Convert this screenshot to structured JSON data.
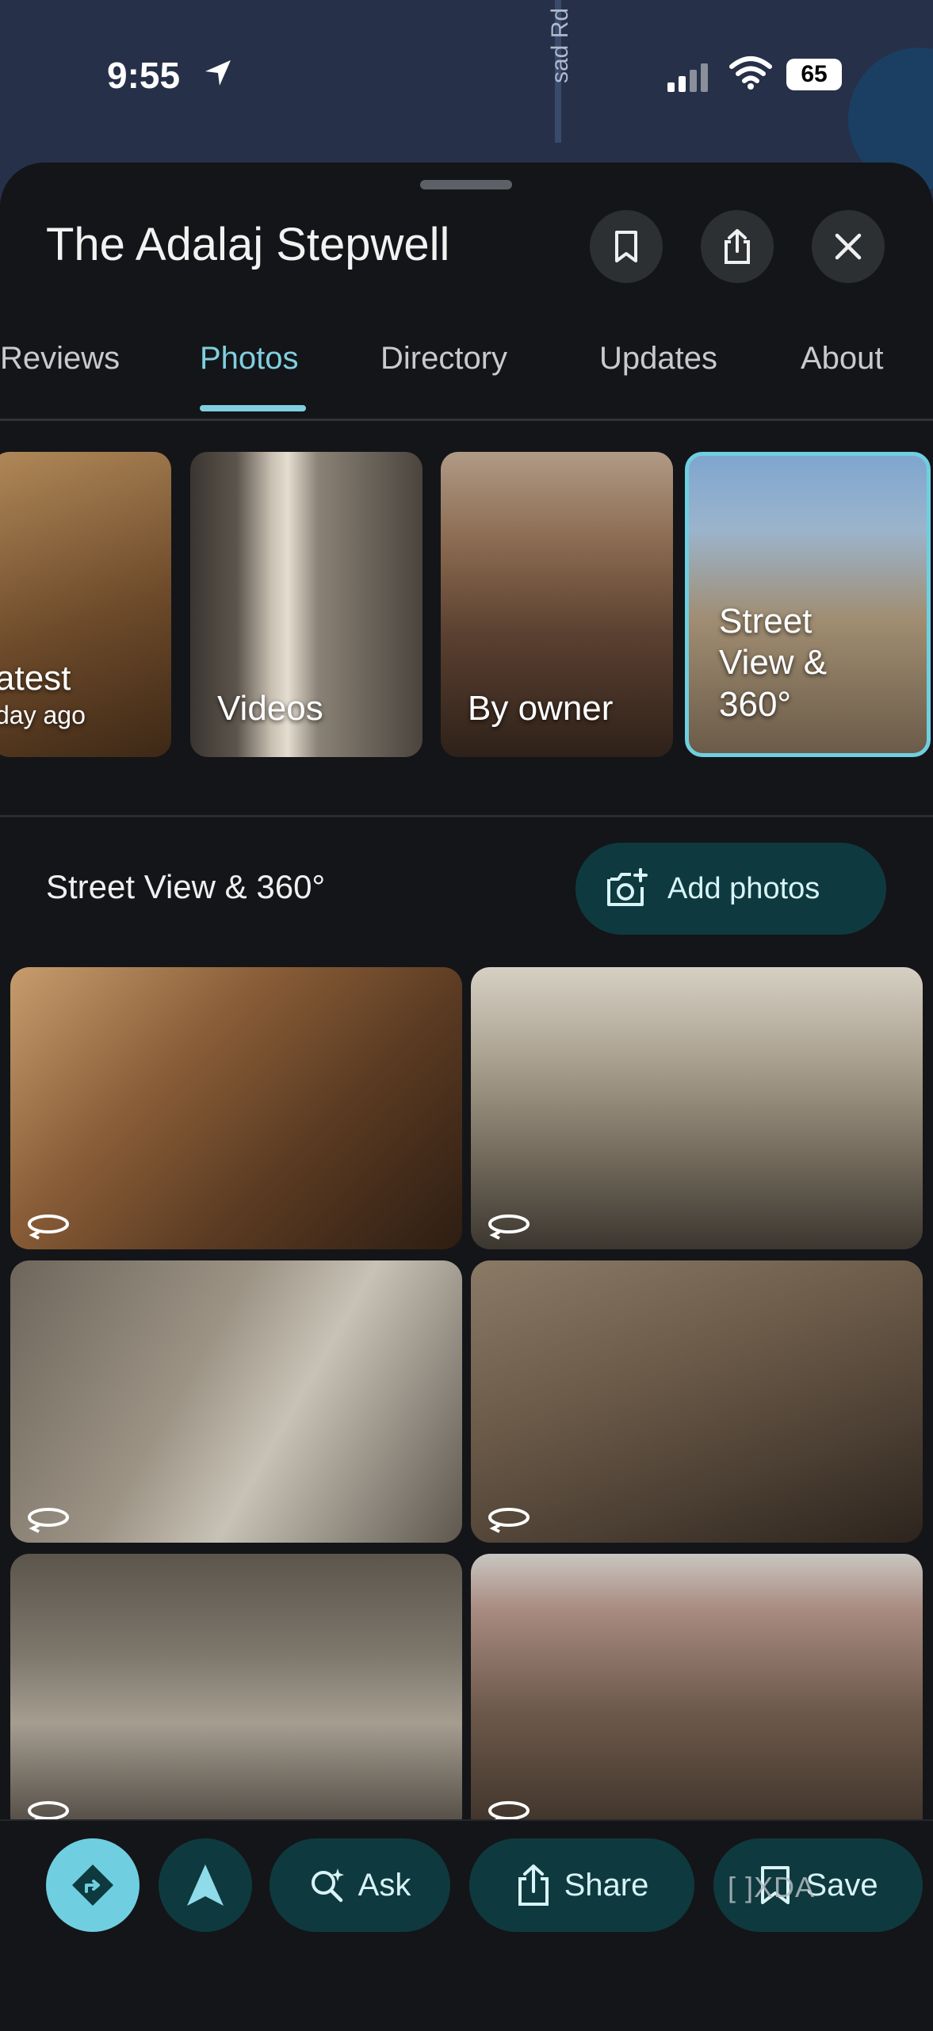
{
  "status_bar": {
    "time": "9:55",
    "battery": "65"
  },
  "map": {
    "road_label": "sad Rd"
  },
  "place": {
    "title": "The Adalaj Stepwell"
  },
  "tabs": [
    {
      "label": "Reviews"
    },
    {
      "label": "Photos"
    },
    {
      "label": "Directory"
    },
    {
      "label": "Updates"
    },
    {
      "label": "About"
    }
  ],
  "categories": [
    {
      "label": "atest",
      "sub": "day ago"
    },
    {
      "label": "Videos"
    },
    {
      "label": "By owner"
    },
    {
      "label": "Street View & 360°"
    }
  ],
  "section": {
    "title": "Street View & 360°",
    "add_label": "Add photos"
  },
  "bottom_actions": {
    "ask": "Ask",
    "share": "Share",
    "save": "Save"
  },
  "watermark": "[ ]XDA",
  "colors": {
    "accent": "#7fcfe0",
    "pill": "#0e3a3f",
    "sheet": "#141518"
  }
}
